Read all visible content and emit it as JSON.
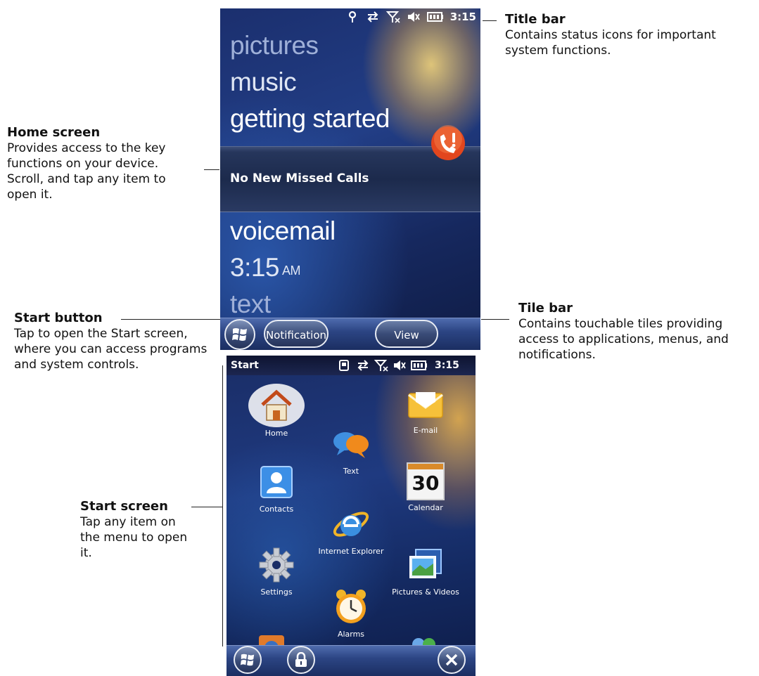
{
  "callouts": {
    "title_bar": {
      "title": "Title bar",
      "desc": "Contains status icons for important system functions."
    },
    "home_screen": {
      "title": "Home screen",
      "desc": "Provides access to the key functions on your device. Scroll, and tap any item to open it."
    },
    "start_button": {
      "title": "Start button",
      "desc": "Tap to open the Start screen, where you can access programs and system controls."
    },
    "tile_bar": {
      "title": "Tile bar",
      "desc": "Contains touchable tiles providing access to applications, menus, and notifications."
    },
    "start_screen": {
      "title": "Start screen",
      "desc": "Tap any item on the menu to open it."
    }
  },
  "home": {
    "status_time": "3:15",
    "items": [
      "pictures",
      "music",
      "getting started"
    ],
    "missed_calls": "No New Missed Calls",
    "voicemail": "voicemail",
    "clock_time": "3:15",
    "clock_ampm": "AM",
    "text": "text",
    "notification_label": "Notification",
    "view_label": "View",
    "colors": {
      "accent": "#1f3a80",
      "highlight": "#ffb43c"
    }
  },
  "start": {
    "title": "Start",
    "status_time": "3:15",
    "apps": {
      "home": "Home",
      "email": "E-mail",
      "text": "Text",
      "contacts": "Contacts",
      "calendar": "Calendar",
      "calendar_day": "30",
      "ie": "Internet Explorer",
      "settings": "Settings",
      "pictures": "Pictures & Videos",
      "alarms": "Alarms"
    }
  }
}
